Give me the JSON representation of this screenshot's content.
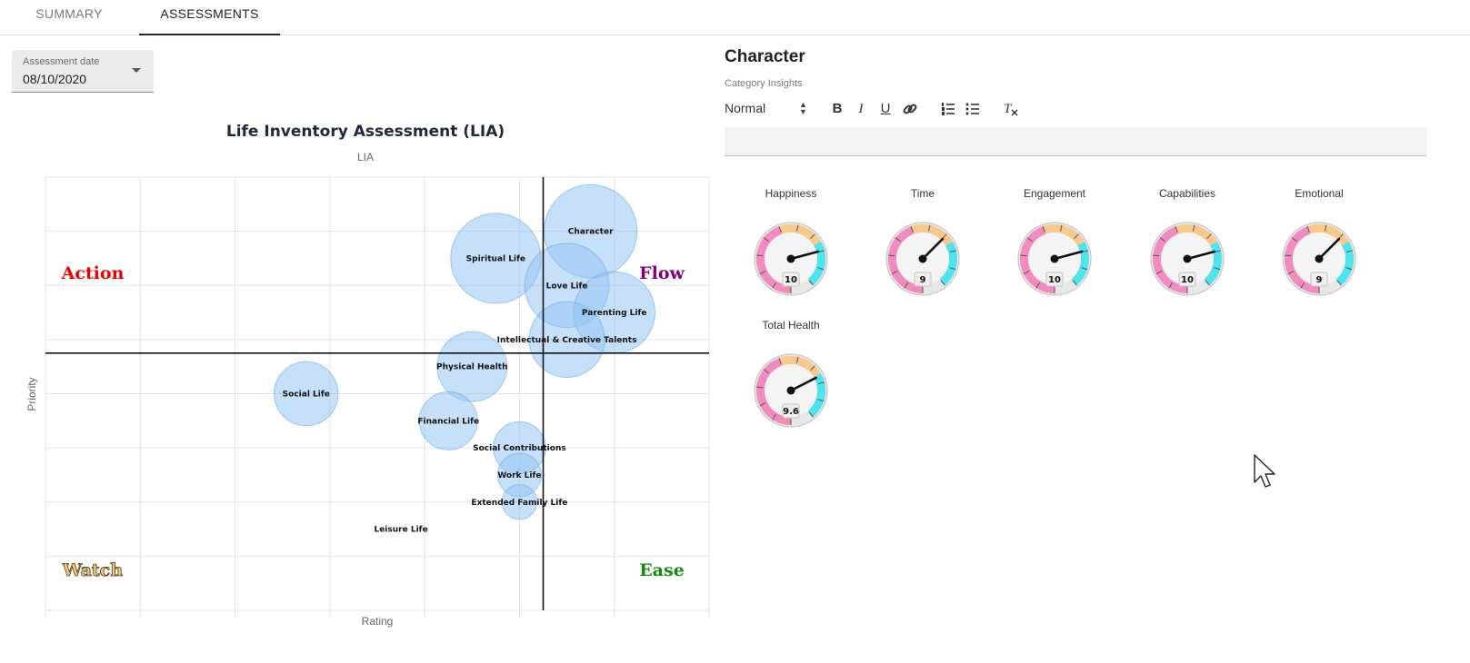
{
  "tabs": [
    {
      "label": "SUMMARY",
      "active": false
    },
    {
      "label": "ASSESSMENTS",
      "active": true
    }
  ],
  "assessment_date": {
    "label": "Assessment date",
    "value": "08/10/2020"
  },
  "chart_data": {
    "type": "scatter",
    "title": "Life Inventory Assessment (LIA)",
    "subtitle": "LIA",
    "xlabel": "Rating",
    "ylabel": "Priority",
    "grid": true,
    "quadrants": [
      {
        "label": "Action",
        "position": "top-left",
        "color": "#ee0000"
      },
      {
        "label": "Flow",
        "position": "top-right",
        "color": "#800080"
      },
      {
        "label": "Watch",
        "position": "bottom-left",
        "color": "#f7c978"
      },
      {
        "label": "Ease",
        "position": "bottom-right",
        "color": "#138a13"
      }
    ],
    "points": [
      {
        "label": "Character",
        "x": 5.75,
        "y": 7.0,
        "size": 3.2
      },
      {
        "label": "Spiritual Life",
        "x": 4.75,
        "y": 6.5,
        "size": 3.1
      },
      {
        "label": "Love Life",
        "x": 5.5,
        "y": 6.0,
        "size": 2.9
      },
      {
        "label": "Parenting Life",
        "x": 6.0,
        "y": 5.5,
        "size": 2.8
      },
      {
        "label": "Intellectual & Creative Talents",
        "x": 5.5,
        "y": 5.0,
        "size": 2.6
      },
      {
        "label": "Physical Health",
        "x": 4.5,
        "y": 4.5,
        "size": 2.4
      },
      {
        "label": "Social Life",
        "x": 2.75,
        "y": 4.0,
        "size": 2.2
      },
      {
        "label": "Financial Life",
        "x": 4.25,
        "y": 3.5,
        "size": 2.0
      },
      {
        "label": "Social Contributions",
        "x": 5.0,
        "y": 3.0,
        "size": 1.8
      },
      {
        "label": "Work Life",
        "x": 5.0,
        "y": 2.5,
        "size": 1.5
      },
      {
        "label": "Extended Family Life",
        "x": 5.0,
        "y": 2.0,
        "size": 1.2
      },
      {
        "label": "Leisure Life",
        "x": 3.75,
        "y": 1.5,
        "size": 0
      }
    ],
    "xlim": [
      0,
      7
    ],
    "ylim": [
      0,
      8
    ],
    "x_divider": 5.25,
    "y_divider": 4.75
  },
  "category": {
    "title": "Character",
    "insights_label": "Category Insights",
    "format_value": "Normal"
  },
  "gauges": [
    {
      "name": "Happiness",
      "value": 10
    },
    {
      "name": "Time",
      "value": 9
    },
    {
      "name": "Engagement",
      "value": 10
    },
    {
      "name": "Capabilities",
      "value": 10
    },
    {
      "name": "Emotional",
      "value": 9
    },
    {
      "name": "Total Health",
      "value": 9.6
    }
  ],
  "colors": {
    "bubble_fill": "#90c2f3",
    "bubble_stroke": "#6aa9ea",
    "gauge_pink": "#f28cc0",
    "gauge_orange": "#f9c98c",
    "gauge_cyan": "#4fe3ee"
  }
}
